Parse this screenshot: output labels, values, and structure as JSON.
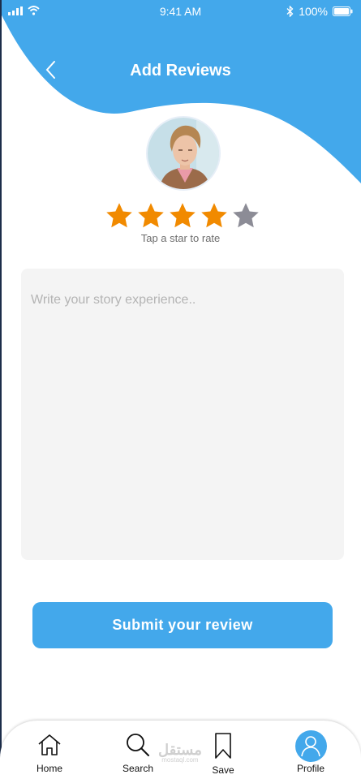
{
  "status_bar": {
    "time": "9:41 AM",
    "battery": "100%",
    "icons": [
      "signal-icon",
      "wifi-icon",
      "bluetooth-icon",
      "battery-icon"
    ]
  },
  "header": {
    "title": "Add Reviews",
    "back_icon": "chevron-left-icon"
  },
  "rating": {
    "value": 4,
    "max": 5,
    "hint": "Tap a star to rate",
    "active_color": "#f18a00",
    "inactive_color": "#8c8c96"
  },
  "review": {
    "placeholder": "Write your story experience..",
    "value": ""
  },
  "submit": {
    "label": "Submit your review"
  },
  "tabbar": {
    "items": [
      {
        "label": "Home",
        "icon": "home-icon"
      },
      {
        "label": "Search",
        "icon": "search-icon"
      },
      {
        "label": "Save",
        "icon": "bookmark-icon"
      },
      {
        "label": "Profile",
        "icon": "profile-icon",
        "active": true
      }
    ]
  },
  "watermark": {
    "text": "مستقل",
    "sub": "mostaql.com"
  },
  "colors": {
    "accent": "#43a8eb",
    "background": "#ffffff",
    "input_bg": "#f4f4f4"
  }
}
